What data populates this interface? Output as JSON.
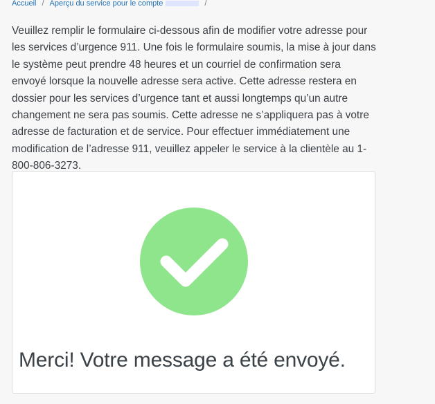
{
  "breadcrumb": {
    "home": "Accueil",
    "separator": "/",
    "account_overview": "Aperçu du service pour le compte"
  },
  "intro_text": "Veuillez remplir le formulaire ci-dessous afin de modifier votre adresse pour les services d’urgence 911. Une fois le formulaire soumis, la mise à jour dans le système peut prendre 48 heures et un courriel de confirmation sera envoyé lorsque la nouvelle adresse sera active. Cette adresse restera en dossier pour les services d’urgence tant et aussi longtemps qu’un autre changement ne sera pas soumis. Cette adresse ne s’appliquera pas à votre adresse de facturation et de service. Pour effectuer immédiatement une modification de l’adresse 911, veuillez appeler le service à la clientèle au 1-800-806-3273.",
  "confirmation": {
    "icon": "check-circle-icon",
    "message": "Merci! Votre message a été envoyé."
  },
  "colors": {
    "link": "#1f6fb2",
    "success_circle": "#8fe58b",
    "text": "#3a3f44"
  }
}
